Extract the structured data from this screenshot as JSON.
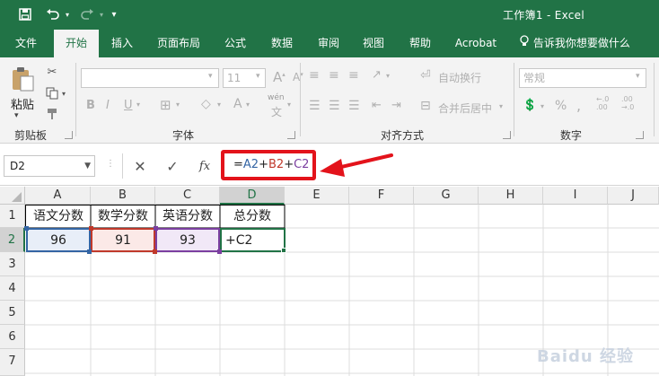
{
  "titlebar": {
    "doc_title": "工作簿1  -  Excel",
    "save_icon": "save-icon",
    "undo_icon": "undo-icon",
    "redo_icon": "redo-icon",
    "customize_icon": "customize-toolbar-icon"
  },
  "tabs": [
    {
      "label": "文件",
      "active": false
    },
    {
      "label": "开始",
      "active": true
    },
    {
      "label": "插入",
      "active": false
    },
    {
      "label": "页面布局",
      "active": false
    },
    {
      "label": "公式",
      "active": false
    },
    {
      "label": "数据",
      "active": false
    },
    {
      "label": "审阅",
      "active": false
    },
    {
      "label": "视图",
      "active": false
    },
    {
      "label": "帮助",
      "active": false
    },
    {
      "label": "Acrobat",
      "active": false
    }
  ],
  "tell_me": "告诉我你想要做什么",
  "ribbon": {
    "clipboard": {
      "label": "剪贴板",
      "paste": "粘贴"
    },
    "font": {
      "label": "字体",
      "size": "11",
      "wen": "wén"
    },
    "alignment": {
      "label": "对齐方式",
      "wrap": "自动换行",
      "merge": "合并后居中"
    },
    "number": {
      "label": "数字",
      "format": "常规"
    }
  },
  "formula_bar": {
    "name_box": "D2",
    "cancel_icon": "cancel-icon",
    "enter_icon": "enter-icon",
    "fx": "fx",
    "formula_parts": [
      {
        "text": "=",
        "color": "#222222"
      },
      {
        "text": "A2",
        "color": "#3465a4"
      },
      {
        "text": "+",
        "color": "#222222"
      },
      {
        "text": "B2",
        "color": "#c0392b"
      },
      {
        "text": "+",
        "color": "#222222"
      },
      {
        "text": "C2",
        "color": "#7b3fa0"
      }
    ]
  },
  "sheet": {
    "columns": [
      "A",
      "B",
      "C",
      "D",
      "E",
      "F",
      "G",
      "H",
      "I",
      "J"
    ],
    "rows": [
      "1",
      "2",
      "3",
      "4",
      "5",
      "6",
      "7"
    ],
    "cells": {
      "A1": "语文分数",
      "B1": "数学分数",
      "C1": "英语分数",
      "D1": "总分数",
      "A2": "96",
      "B2": "91",
      "C2": "93",
      "D2": "+C2"
    },
    "selected_cell": "D2"
  },
  "colors": {
    "excel_green": "#217346",
    "ref_blue": "#3465a4",
    "ref_red": "#c0392b",
    "ref_purple": "#7b3fa0",
    "annotation_red": "#e3131b"
  },
  "watermark": "Baidu 经验"
}
